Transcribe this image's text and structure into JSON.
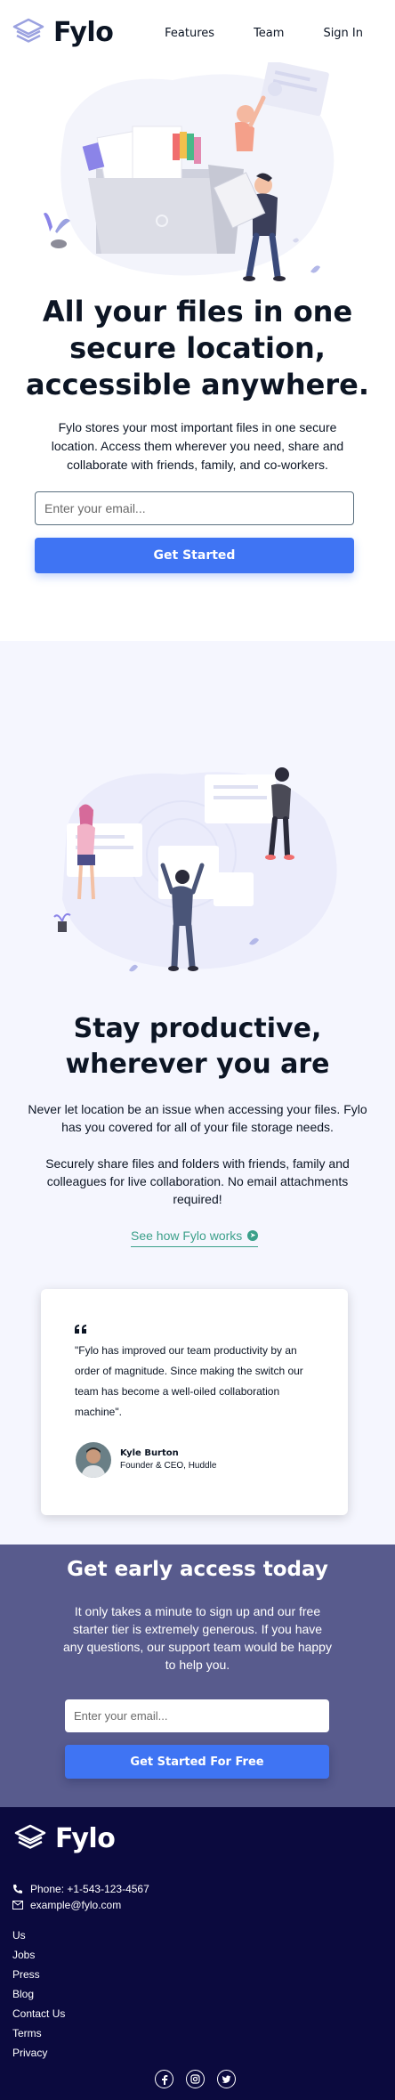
{
  "brand": {
    "name": "Fylo"
  },
  "nav": {
    "links": [
      "Features",
      "Team",
      "Sign In"
    ]
  },
  "hero": {
    "title": "All your files in one secure location, accessible anywhere.",
    "text": "Fylo stores your most important files in one secure location. Access them wherever you need, share and collaborate with friends, family, and co-workers.",
    "email_placeholder": "Enter your email...",
    "button_label": "Get Started"
  },
  "productive": {
    "title": "Stay productive, wherever you are",
    "paragraph1": "Never let location be an issue when accessing your files. Fylo has you covered for all of your file storage needs.",
    "paragraph2": "Securely share files and folders with friends, family and colleagues for live collaboration. No email attachments required!",
    "link_label": "See how Fylo works"
  },
  "testimonial": {
    "quote": "\"Fylo has improved our team productivity by an order of magnitude. Since making the switch our team has become a well-oiled collaboration machine\".",
    "name": "Kyle Burton",
    "role": "Founder & CEO, Huddle"
  },
  "early_access": {
    "title": "Get early access today",
    "text": "It only takes a minute to sign up and our free starter tier is extremely generous. If you have any questions, our support team would be happy to help you.",
    "email_placeholder": "Enter your email...",
    "button_label": "Get Started For Free"
  },
  "footer": {
    "phone": "Phone: +1-543-123-4567",
    "email": "example@fylo.com",
    "links": [
      "Us",
      "Jobs",
      "Press",
      "Blog",
      "Contact Us",
      "Terms",
      "Privacy"
    ],
    "social_icons": [
      "facebook-icon",
      "instagram-icon",
      "twitter-icon"
    ]
  },
  "colors": {
    "navy": "#0c1524",
    "accent_blue": "#3f74f3",
    "teal": "#3ba08a",
    "section_bg": "#f5f6fe",
    "early_bg": "#585b8d",
    "footer_bg": "#0b0a3e"
  }
}
